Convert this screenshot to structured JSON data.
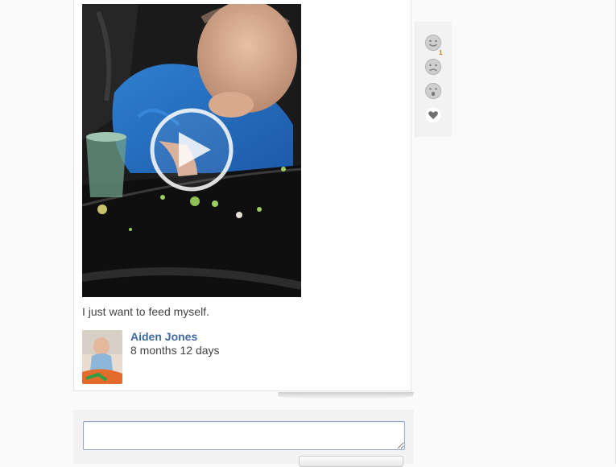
{
  "post": {
    "caption": "I just want to feed myself.",
    "video_play_icon": "play-icon"
  },
  "author": {
    "name": "Aiden Jones",
    "age": "8 months 12 days"
  },
  "reactions": {
    "items": [
      {
        "icon": "smile-icon",
        "count": "1"
      },
      {
        "icon": "frown-icon",
        "count": ""
      },
      {
        "icon": "surprised-icon",
        "count": ""
      },
      {
        "icon": "heart-icon",
        "count": ""
      }
    ]
  },
  "comment": {
    "value": "",
    "submit_label": ""
  },
  "colors": {
    "author_link": "#3d6aa2",
    "count_badge": "#e07b00",
    "input_border": "#8ea8d6"
  }
}
